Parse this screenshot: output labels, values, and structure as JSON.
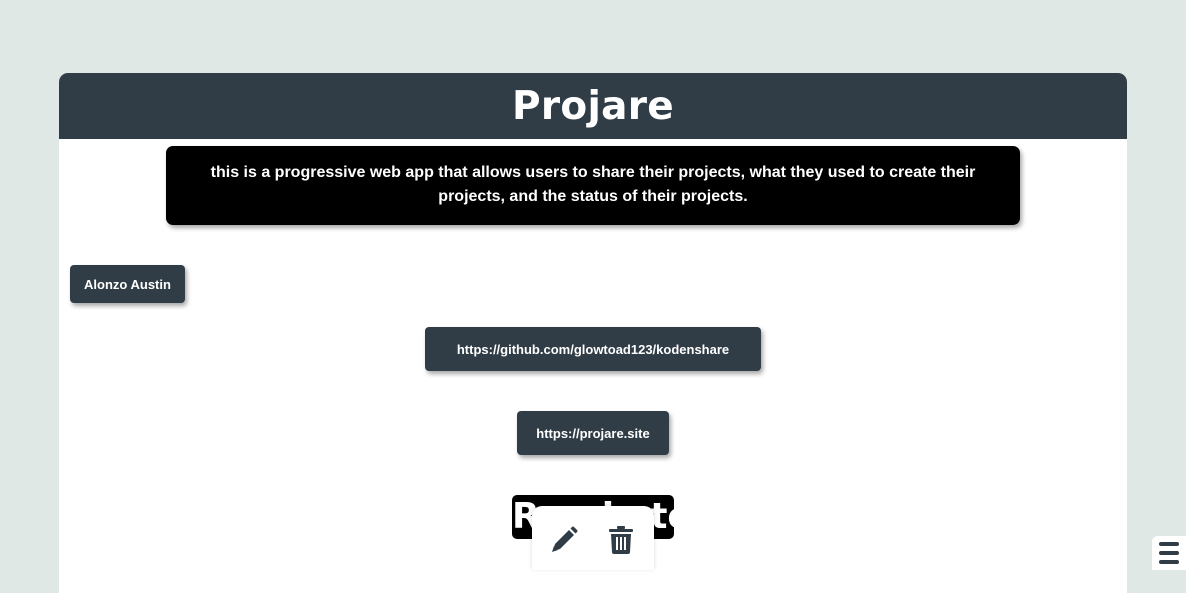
{
  "app": {
    "title": "Projare"
  },
  "project": {
    "description": "this is a progressive web app that allows users to share their projects, what they used to create their projects, and the status of their projects.",
    "author": "Alonzo Austin",
    "repo_url": "https://github.com/glowtoad123/kodenshare",
    "site_url": "https://projare.site",
    "status": "Ready to Ship"
  },
  "actions": {
    "edit_icon": "pencil-icon",
    "delete_icon": "trash-icon"
  },
  "menu": {
    "icon": "hamburger-menu-icon"
  },
  "colors": {
    "background": "#e0e8e6",
    "header": "#313d46",
    "card": "#ffffff",
    "chip": "#313d46",
    "description_box": "#000000",
    "icon": "#313d46"
  }
}
